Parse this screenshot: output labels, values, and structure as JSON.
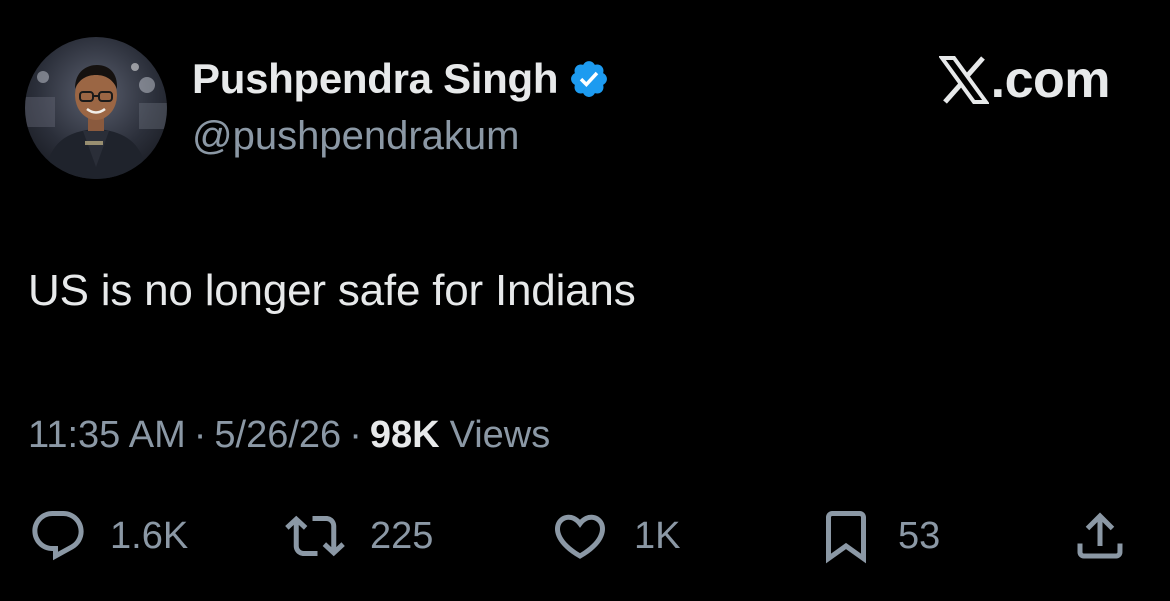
{
  "author": {
    "display_name": "Pushpendra Singh",
    "handle": "@pushpendrakum",
    "verified": true,
    "verified_color": "#1d9bf0"
  },
  "brand": {
    "label": ".com",
    "logo_icon": "x-logo-icon"
  },
  "tweet": {
    "text": "US is no longer safe for Indians"
  },
  "meta": {
    "time": "11:35 AM",
    "separator": "·",
    "date": "5/26/26",
    "views_count": "98K",
    "views_label": "Views"
  },
  "actions": {
    "replies": {
      "icon": "reply-icon",
      "count": "1.6K"
    },
    "reposts": {
      "icon": "repost-icon",
      "count": "225"
    },
    "likes": {
      "icon": "heart-icon",
      "count": "1K"
    },
    "bookmarks": {
      "icon": "bookmark-icon",
      "count": "53"
    },
    "share": {
      "icon": "share-icon"
    }
  },
  "colors": {
    "background": "#000000",
    "primary_text": "#e7e9ea",
    "secondary_text": "#8b98a5",
    "accent": "#1d9bf0"
  }
}
